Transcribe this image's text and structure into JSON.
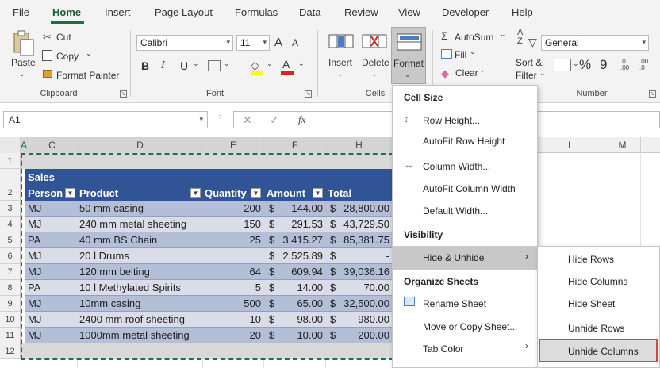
{
  "menu": {
    "tabs": [
      "File",
      "Home",
      "Insert",
      "Page Layout",
      "Formulas",
      "Data",
      "Review",
      "View",
      "Developer",
      "Help"
    ],
    "active_tab": "Home"
  },
  "ribbon": {
    "clipboard": {
      "paste": "Paste",
      "cut": "Cut",
      "copy": "Copy",
      "format_painter": "Format Painter",
      "group": "Clipboard"
    },
    "font": {
      "font_name": "Calibri",
      "font_size": "11",
      "bold": "B",
      "italic": "I",
      "underline": "U",
      "grow": "A",
      "shrink": "A",
      "font_color": "A",
      "group": "Font"
    },
    "cells": {
      "insert": "Insert",
      "delete": "Delete",
      "format": "Format",
      "group": "Cells"
    },
    "editing": {
      "autosum": "AutoSum",
      "fill": "Fill",
      "clear": "Clear",
      "sort_filter_1": "Sort &",
      "sort_filter_2": "Filter"
    },
    "number": {
      "format": "General",
      "percent": "%",
      "comma": "9",
      "group": "Number"
    }
  },
  "formula_bar": {
    "name_box": "A1",
    "fx": "fx"
  },
  "columns": [
    "A",
    "C",
    "D",
    "E",
    "F",
    "H",
    "L",
    "M"
  ],
  "rows": [
    "1",
    "2",
    "3",
    "4",
    "5",
    "6",
    "7",
    "8",
    "9",
    "10",
    "11",
    "12"
  ],
  "table": {
    "title": "Sales",
    "headers": [
      "Person",
      "Product",
      "Quantity",
      "Amount",
      "Total"
    ],
    "rows": [
      {
        "person": "MJ",
        "product": "50 mm casing",
        "qty": "200",
        "amt": "144.00",
        "total": "28,800.00"
      },
      {
        "person": "MJ",
        "product": "240 mm metal sheeting",
        "qty": "150",
        "amt": "291.53",
        "total": "43,729.50"
      },
      {
        "person": "PA",
        "product": "40 mm BS Chain",
        "qty": "25",
        "amt": "3,415.27",
        "total": "85,381.75"
      },
      {
        "person": "MJ",
        "product": "20 l Drums",
        "qty": "",
        "amt": "2,525.89",
        "total": "-"
      },
      {
        "person": "MJ",
        "product": "120 mm belting",
        "qty": "64",
        "amt": "609.94",
        "total": "39,036.16"
      },
      {
        "person": "PA",
        "product": "10 l Methylated Spirits",
        "qty": "5",
        "amt": "14.00",
        "total": "70.00"
      },
      {
        "person": "MJ",
        "product": "10mm casing",
        "qty": "500",
        "amt": "65.00",
        "total": "32,500.00"
      },
      {
        "person": "MJ",
        "product": "2400 mm roof sheeting",
        "qty": "10",
        "amt": "98.00",
        "total": "980.00"
      },
      {
        "person": "MJ",
        "product": "1000mm metal sheeting",
        "qty": "20",
        "amt": "10.00",
        "total": "200.00"
      }
    ],
    "currency": "$"
  },
  "format_menu": {
    "cell_size": "Cell Size",
    "row_height": "Row Height...",
    "autofit_row": "AutoFit Row Height",
    "column_width": "Column Width...",
    "autofit_column": "AutoFit Column Width",
    "default_width": "Default Width...",
    "visibility": "Visibility",
    "hide_unhide": "Hide & Unhide",
    "organize": "Organize Sheets",
    "rename": "Rename Sheet",
    "move_copy": "Move or Copy Sheet...",
    "tab_color": "Tab Color"
  },
  "sub_menu": {
    "hide_rows": "Hide Rows",
    "hide_columns": "Hide Columns",
    "hide_sheet": "Hide Sheet",
    "unhide_rows": "Unhide Rows",
    "unhide_columns": "Unhide Columns"
  },
  "colors": {
    "accent": "#1e7145",
    "table_header": "#305496",
    "table_row": "#b4bed6",
    "highlight": "#e04040"
  }
}
